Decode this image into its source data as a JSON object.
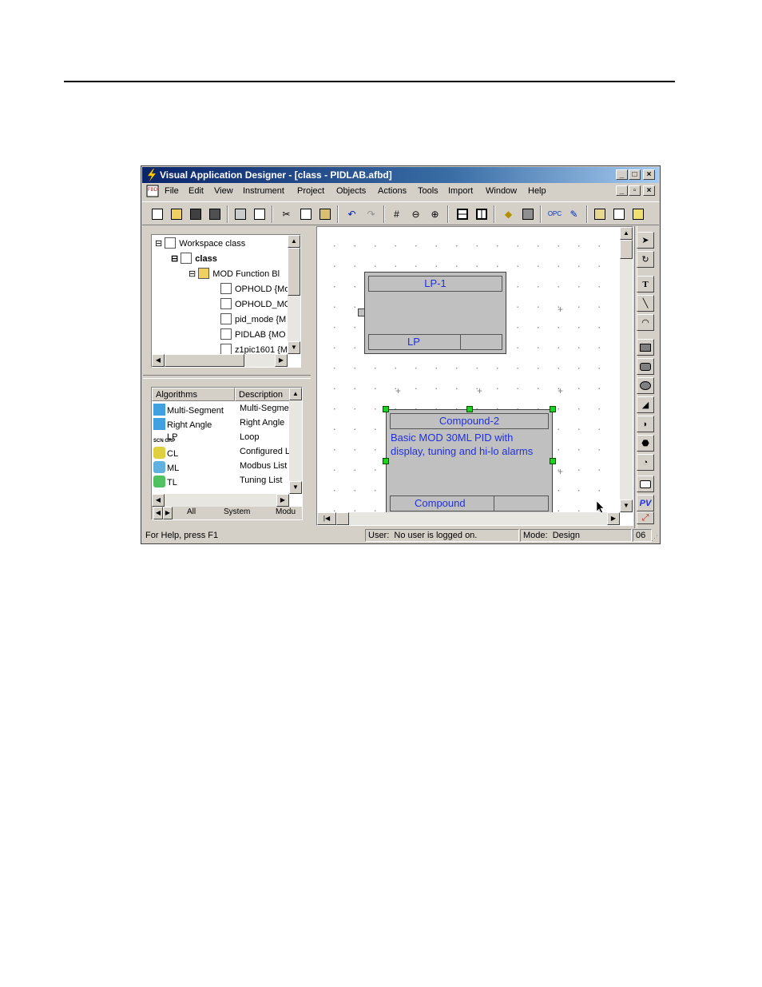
{
  "window": {
    "title": "Visual Application Designer - [class - PIDLAB.afbd]"
  },
  "menu": [
    "File",
    "Edit",
    "View",
    "Instrument",
    "Project",
    "Objects",
    "Actions",
    "Tools",
    "Import",
    "Window",
    "Help"
  ],
  "toolbar_icons": [
    "new-icon",
    "open-icon",
    "save-icon",
    "save-all-icon",
    "print-icon",
    "print-preview-icon",
    "cut-icon",
    "copy-icon",
    "paste-icon",
    "undo-icon",
    "redo-icon",
    "grid-icon",
    "zoom-out-icon",
    "zoom-in-icon",
    "split-horizontal-icon",
    "split-vertical-icon",
    "tag-icon",
    "object-icon",
    "opc-icon",
    "edit-icon",
    "window-1-icon",
    "window-2-icon",
    "window-3-icon"
  ],
  "tree": {
    "items": [
      {
        "label": "Workspace class"
      },
      {
        "label": "class"
      },
      {
        "label": "MOD Function Bl"
      },
      {
        "label": "OPHOLD {Mo"
      },
      {
        "label": "OPHOLD_MO"
      },
      {
        "label": "pid_mode {M"
      },
      {
        "label": "PIDLAB {MO"
      },
      {
        "label": "z1pic1601 {M"
      }
    ]
  },
  "algorithms": {
    "col1": "Algorithms",
    "col2": "Description",
    "rows": [
      {
        "name": "Multi-Segment",
        "desc": "Multi-Segme",
        "icon": "multi-segment-icon"
      },
      {
        "name": "Right Angle",
        "desc": "Right Angle",
        "icon": "right-angle-icon"
      },
      {
        "name": "LP",
        "desc": "Loop",
        "icon": "loop-icon",
        "icon_text": "SCN GRP"
      },
      {
        "name": "CL",
        "desc": "Configured L",
        "icon": "configured-list-icon"
      },
      {
        "name": "ML",
        "desc": "Modbus List",
        "icon": "modbus-list-icon"
      },
      {
        "name": "TL",
        "desc": "Tuning List",
        "icon": "tuning-list-icon"
      }
    ],
    "tabs": [
      "All",
      "System",
      "Modu"
    ]
  },
  "canvas": {
    "block1": {
      "title": "LP-1",
      "footer": "LP"
    },
    "block2": {
      "title": "Compound-2",
      "body": "Basic MOD 30ML  PID with display, tuning and hi-lo alarms",
      "footer": "Compound"
    }
  },
  "right_tools": {
    "pv_label": "PV"
  },
  "status": {
    "help": "For Help, press F1",
    "user_label": "User:",
    "user_value": "No user is logged on.",
    "mode_label": "Mode:",
    "mode_value": "Design",
    "extra": "06"
  }
}
